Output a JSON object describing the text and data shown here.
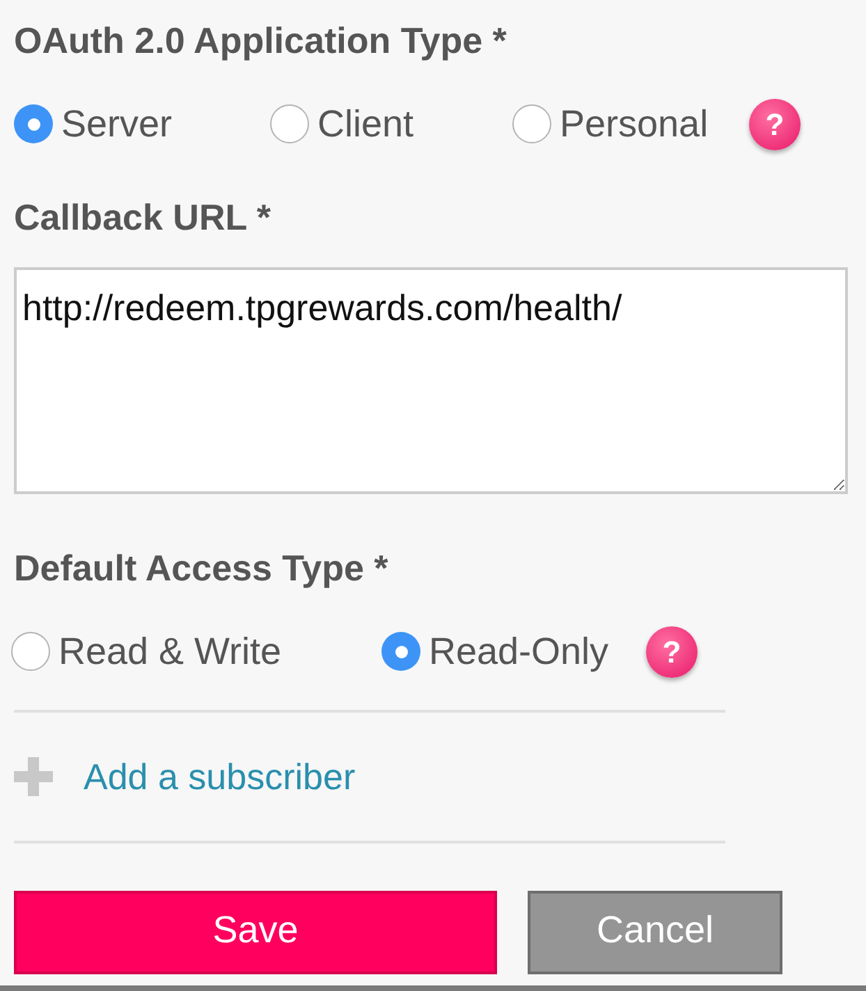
{
  "app_type": {
    "label": "OAuth 2.0 Application Type *",
    "options": [
      {
        "label": "Server",
        "selected": true
      },
      {
        "label": "Client",
        "selected": false
      },
      {
        "label": "Personal",
        "selected": false
      }
    ],
    "help": "?"
  },
  "callback": {
    "label": "Callback URL *",
    "value": "http://redeem.tpgrewards.com/health/"
  },
  "access_type": {
    "label": "Default Access Type *",
    "options": [
      {
        "label": "Read & Write",
        "selected": false
      },
      {
        "label": "Read-Only",
        "selected": true
      }
    ],
    "help": "?"
  },
  "add_subscriber": "Add a subscriber",
  "buttons": [
    {
      "kind": "primary",
      "label": "Save"
    },
    {
      "kind": "secondary",
      "label": "Cancel"
    }
  ]
}
